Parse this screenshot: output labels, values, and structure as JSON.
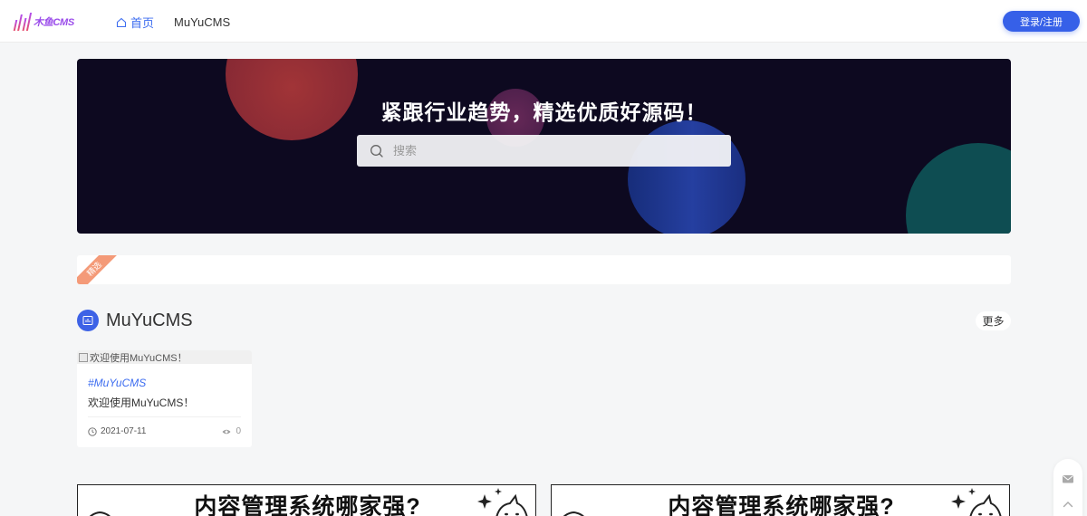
{
  "header": {
    "logo_text": "木鱼CMS",
    "nav": [
      {
        "label": "首页",
        "icon": "home-icon",
        "active": true
      },
      {
        "label": "MuYuCMS",
        "active": false
      }
    ],
    "login_label": "登录/注册"
  },
  "banner": {
    "title": "紧跟行业趋势，精选优质好源码！",
    "search_placeholder": "搜索"
  },
  "featured": {
    "ribbon_label": "精选"
  },
  "section": {
    "title": "MuYuCMS",
    "more_label": "更多"
  },
  "cards": [
    {
      "image_alt": "欢迎使用MuYuCMS！",
      "tag": "#MuYuCMS",
      "title": "欢迎使用MuYuCMS！",
      "date": "2021-07-11",
      "views": "0"
    }
  ],
  "ads": [
    {
      "text": "内容管理系统哪家强?"
    },
    {
      "text": "内容管理系统哪家强?"
    }
  ],
  "colors": {
    "accent": "#3660e8",
    "banner_bg": "#0d0920",
    "ribbon": "#f49a78"
  }
}
